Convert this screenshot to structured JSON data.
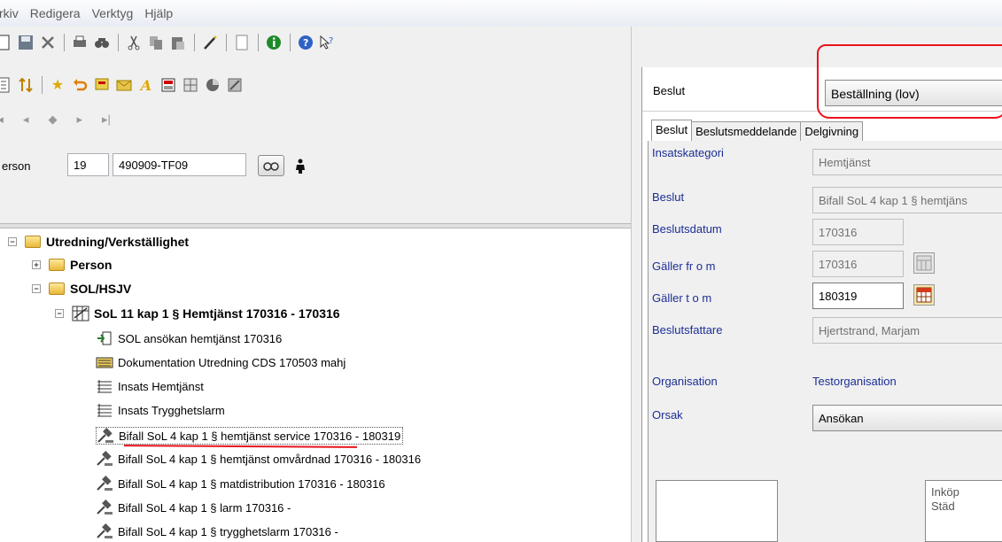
{
  "menu": [
    "rkiv",
    "Redigera",
    "Verktyg",
    "Hjälp"
  ],
  "toolbar1_icons": [
    "new-doc-icon",
    "save-icon",
    "delete-icon",
    "print-icon",
    "find-icon",
    "cut-icon",
    "copy-icon",
    "paste-icon",
    "wand-icon",
    "page-icon",
    "info-icon",
    "help-icon",
    "whats-this-icon"
  ],
  "toolbar2_icons": [
    "list-icon",
    "sort-icon",
    "star-icon",
    "undo-icon",
    "note-icon",
    "mail-icon",
    "signature-icon",
    "form-icon",
    "grid-icon",
    "chart-icon",
    "tools-icon"
  ],
  "nav": [
    "|◂",
    "◂",
    "◆",
    "▸",
    "▸|"
  ],
  "person": {
    "label": "erson",
    "century": "19",
    "pnr": "490909-TF09"
  },
  "tree": {
    "root": "Utredning/Verkställighet",
    "person": "Person",
    "sol": "SOL/HSJV",
    "case": "SoL 11 kap 1 § Hemtjänst 170316 - 170316",
    "items": [
      "SOL ansökan hemtjänst 170316",
      "Dokumentation Utredning CDS 170503 mahj",
      "Insats Hemtjänst",
      "Insats Trygghetslarm",
      "Bifall SoL 4 kap 1 § hemtjänst service 170316 - 180319",
      "Bifall SoL 4 kap 1 § hemtjänst omvårdnad 170316 - 180316",
      "Bifall SoL 4 kap 1 § matdistribution 170316 - 180316",
      "Bifall SoL 4 kap 1 § larm 170316 -",
      "Bifall SoL 4 kap 1 § trygghetslarm 170316 -"
    ]
  },
  "right": {
    "header_label": "Beslut",
    "header_combo": "Beställning (lov)",
    "tabs": [
      "Beslut",
      "Beslutsmeddelande",
      "Delgivning"
    ],
    "fields": {
      "insatskategori_label": "Insatskategori",
      "insatskategori_value": "Hemtjänst",
      "beslut_label": "Beslut",
      "beslut_value": "Bifall SoL 4 kap 1 § hemtjäns",
      "beslutsdatum_label": "Beslutsdatum",
      "beslutsdatum_value": "170316",
      "galler_from_label": "Gäller fr o m",
      "galler_from_value": "170316",
      "galler_tom_label": "Gäller t o m",
      "galler_tom_value": "180319",
      "beslutsfattare_label": "Beslutsfattare",
      "beslutsfattare_value": "Hjertstrand, Marjam",
      "organisation_label": "Organisation",
      "organisation_value": "Testorganisation",
      "orsak_label": "Orsak",
      "orsak_value": "Ansökan"
    },
    "list_items": [
      "Inköp",
      "Städ"
    ]
  },
  "colors": {
    "label_blue": "#1c2e94",
    "annotation_red": "#e8141c"
  }
}
